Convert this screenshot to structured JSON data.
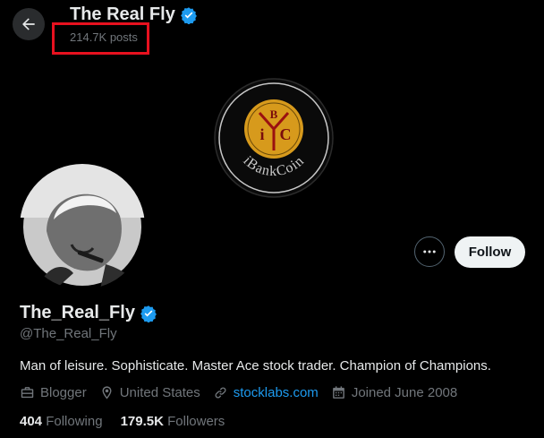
{
  "header": {
    "name": "The Real Fly",
    "posts_count": "214.7K posts"
  },
  "banner": {
    "logo_letters": [
      "B",
      "i",
      "C"
    ],
    "logo_text": "iBankCoin"
  },
  "profile": {
    "display_name": "The_Real_Fly",
    "handle": "@The_Real_Fly",
    "bio": "Man of leisure. Sophisticate. Master Ace stock trader. Champion of Champions.",
    "category": "Blogger",
    "location": "United States",
    "website": "stocklabs.com",
    "joined": "Joined June 2008",
    "following_count": "404",
    "following_label": "Following",
    "followers_count": "179.5K",
    "followers_label": "Followers"
  },
  "actions": {
    "follow_label": "Follow"
  },
  "colors": {
    "verified": "#1d9bf0",
    "highlight": "#e8111f",
    "logo_gold": "#d79a1c",
    "logo_red": "#9a1010"
  }
}
